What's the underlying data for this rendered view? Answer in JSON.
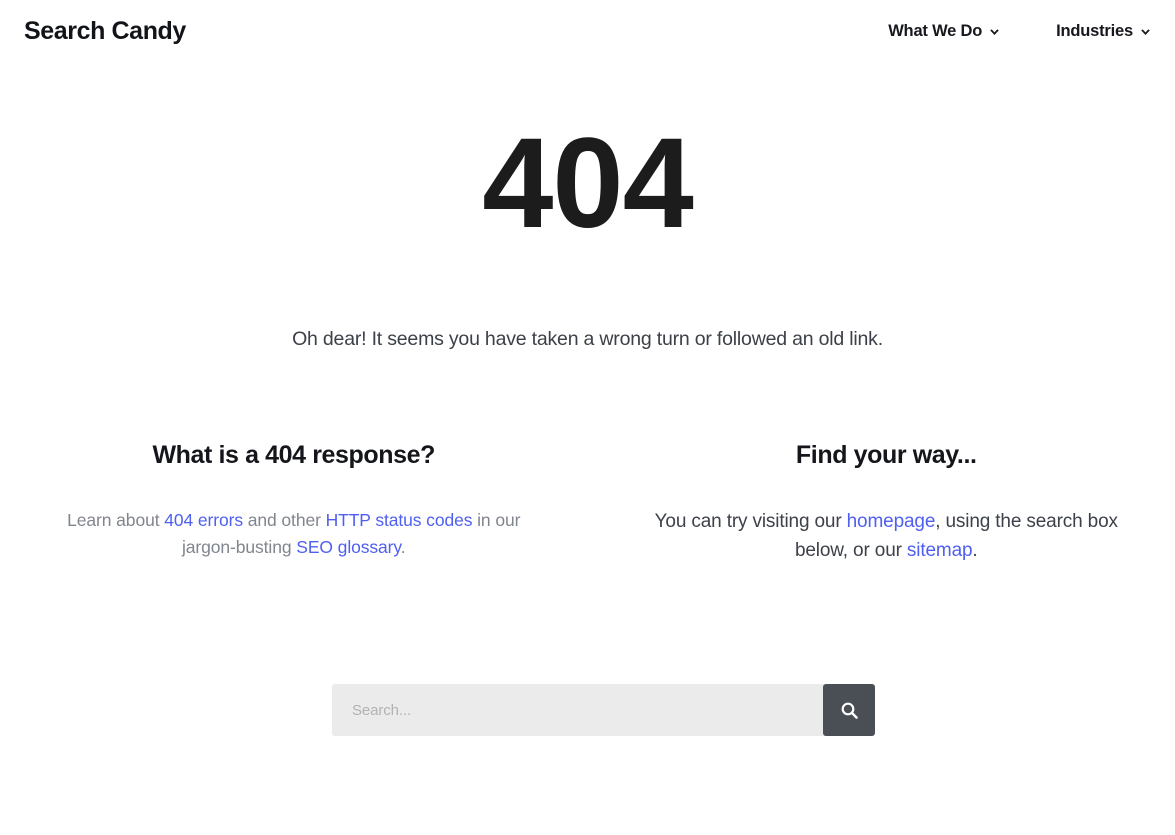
{
  "header": {
    "brand": "Search Candy",
    "nav": [
      {
        "label": "What We Do",
        "icon": "chevron-down-icon"
      },
      {
        "label": "Industries",
        "icon": "chevron-down-icon"
      }
    ]
  },
  "hero": {
    "code": "404",
    "subtitle": "Oh dear! It seems you have taken a wrong turn or followed an old link."
  },
  "columns": {
    "left": {
      "title": "What is a 404 response?",
      "body": {
        "part1": "Learn about ",
        "link1": "404 errors",
        "part2": " and other ",
        "link2": "HTTP status codes",
        "part3": " in our jargon-busting ",
        "link3": "SEO glossary",
        "part4": "."
      }
    },
    "right": {
      "title": "Find your way...",
      "body": {
        "part1": "You can try visiting our ",
        "link1": "homepage",
        "part2": ", using the search box below, or our ",
        "link2": "sitemap",
        "part3": "."
      }
    }
  },
  "search": {
    "placeholder": "Search...",
    "value": "",
    "button_icon": "search-icon"
  },
  "colors": {
    "link": "#4f5ff0",
    "heading": "#14161b",
    "code": "#1c1c1c",
    "left_body": "#81858e",
    "right_body": "#3d4149",
    "search_field_bg": "#ebebeb",
    "search_button_bg": "#4a4e55",
    "page_bg": "#ffffff"
  }
}
